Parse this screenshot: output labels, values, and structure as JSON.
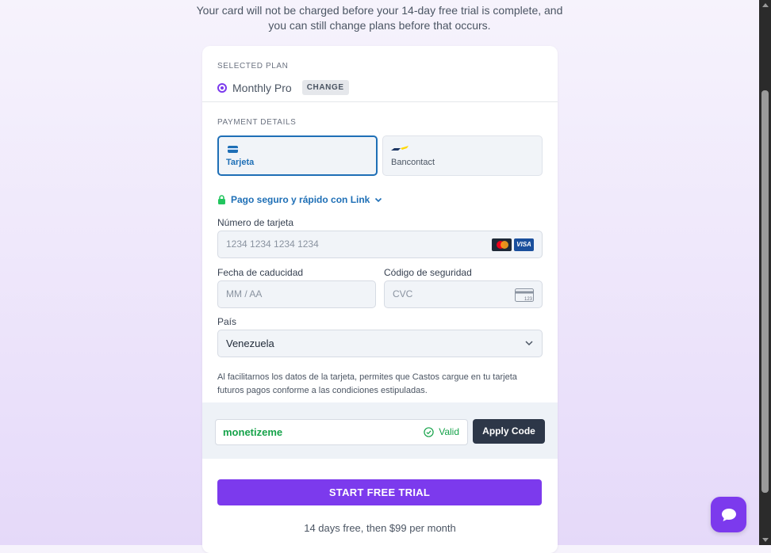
{
  "notice": {
    "line1": "Your card will not be charged before your 14-day free trial is complete, and",
    "line2": "you can still change plans before that occurs."
  },
  "plan": {
    "section_label": "SELECTED PLAN",
    "name": "Monthly Pro",
    "change_label": "CHANGE"
  },
  "payment": {
    "section_label": "PAYMENT DETAILS",
    "methods": [
      {
        "label": "Tarjeta",
        "icon": "credit-card-icon",
        "selected": true
      },
      {
        "label": "Bancontact",
        "icon": "bancontact-icon",
        "selected": false
      }
    ],
    "link_text": "Pago seguro y rápido con Link",
    "card_number_label": "Número de tarjeta",
    "card_number_placeholder": "1234 1234 1234 1234",
    "brands": [
      "mastercard-icon",
      "VISA"
    ],
    "expiry_label": "Fecha de caducidad",
    "expiry_placeholder": "MM / AA",
    "cvc_label": "Código de seguridad",
    "cvc_placeholder": "CVC",
    "cvc_icon_text": "123",
    "country_label": "País",
    "country_value": "Venezuela",
    "legal_line1": "Al facilitarnos los datos de la tarjeta, permites que Castos cargue en tu tarjeta",
    "legal_line2": "futuros pagos conforme a las condiciones estipuladas."
  },
  "promo": {
    "code": "monetizeme",
    "status": "Valid",
    "apply_label": "Apply Code"
  },
  "cta": {
    "label": "START FREE TRIAL",
    "price_note": "14 days free, then $99 per month"
  },
  "colors": {
    "accent": "#7c3aed",
    "link_blue": "#1e6fb6",
    "valid_green": "#16a34a",
    "dark_button": "#2d3748"
  }
}
